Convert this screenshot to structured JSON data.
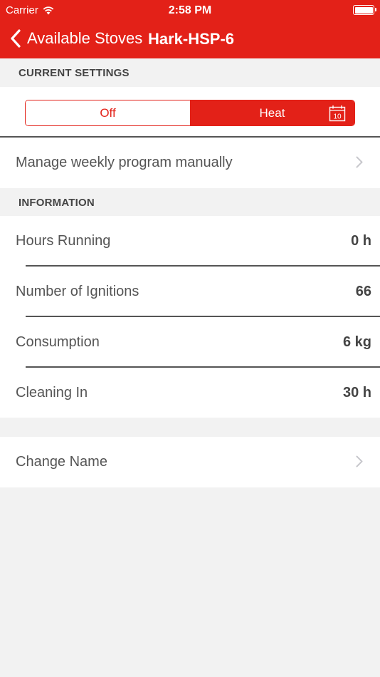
{
  "status_bar": {
    "carrier": "Carrier",
    "time": "2:58 PM"
  },
  "nav": {
    "back_label": "Available Stoves",
    "title": "Hark-HSP-6"
  },
  "current_settings": {
    "header": "CURRENT SETTINGS",
    "mode_options": [
      "Off",
      "Heat"
    ],
    "selected_mode": "Heat",
    "calendar_day": "10"
  },
  "weekly_program": {
    "label": "Manage weekly program manually"
  },
  "information": {
    "header": "INFORMATION",
    "rows": [
      {
        "label": "Hours Running",
        "value": "0 h"
      },
      {
        "label": "Number of Ignitions",
        "value": "66"
      },
      {
        "label": "Consumption",
        "value": "6 kg"
      },
      {
        "label": "Cleaning In",
        "value": "30 h"
      }
    ]
  },
  "change_name": {
    "label": "Change Name"
  },
  "colors": {
    "accent": "#e32118",
    "background": "#f2f2f2"
  }
}
